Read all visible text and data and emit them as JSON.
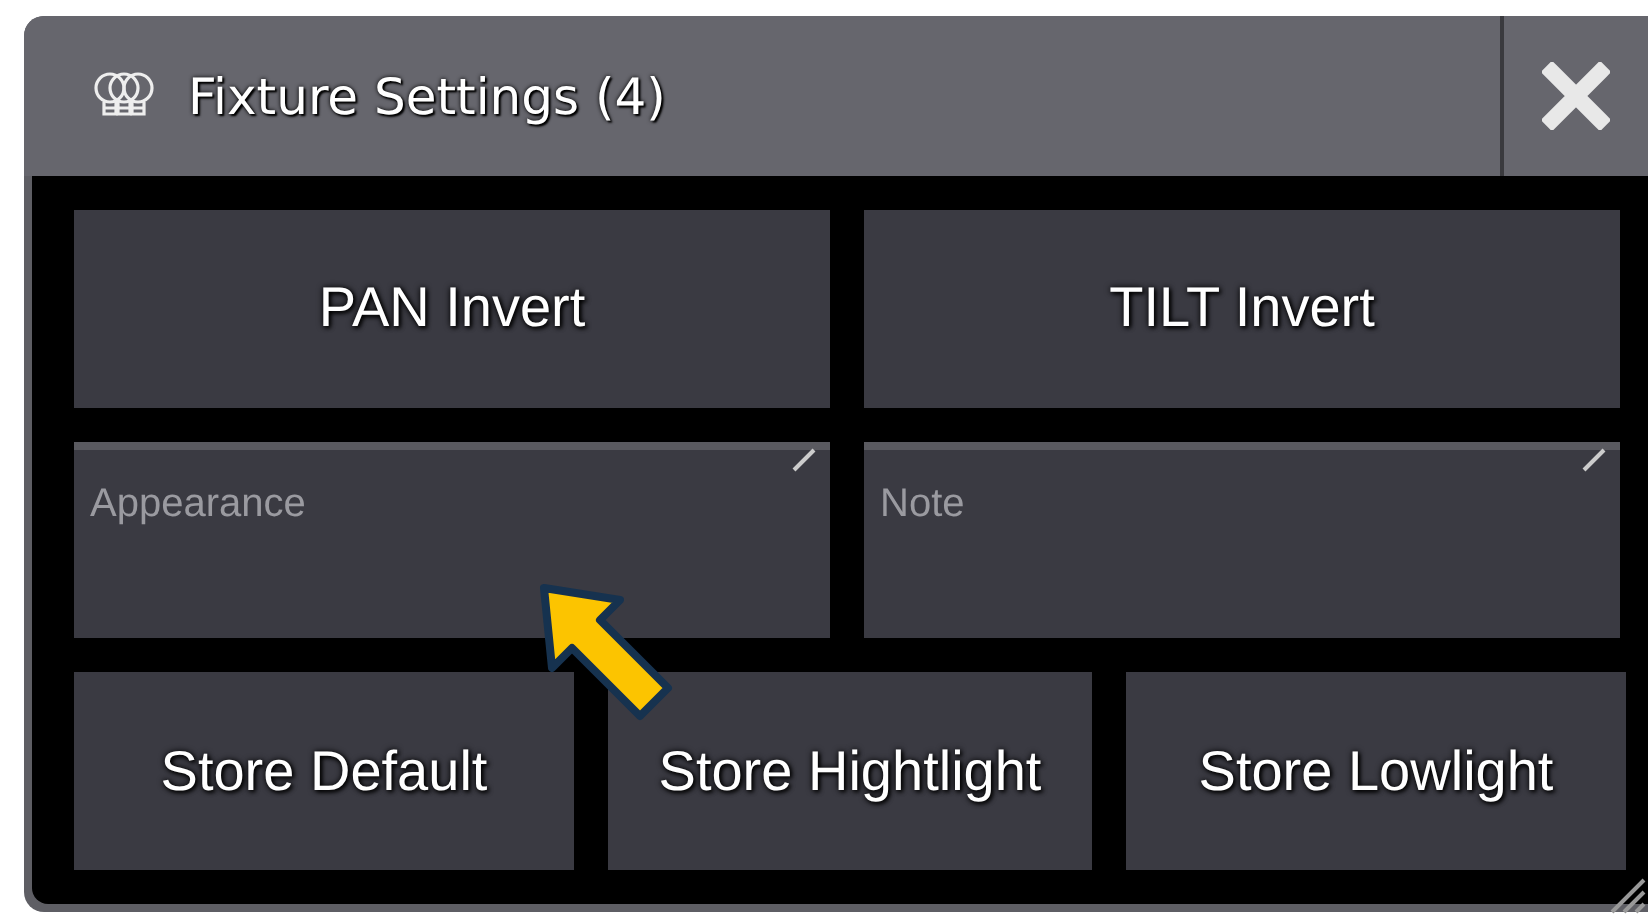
{
  "window": {
    "title": "Fixture Settings (4)"
  },
  "invert_buttons": [
    {
      "label": "PAN Invert"
    },
    {
      "label": "TILT Invert"
    }
  ],
  "fields": [
    {
      "placeholder": "Appearance"
    },
    {
      "placeholder": "Note"
    }
  ],
  "store_buttons": [
    {
      "label": "Store Default"
    },
    {
      "label": "Store Hightlight"
    },
    {
      "label": "Store Lowlight"
    }
  ]
}
